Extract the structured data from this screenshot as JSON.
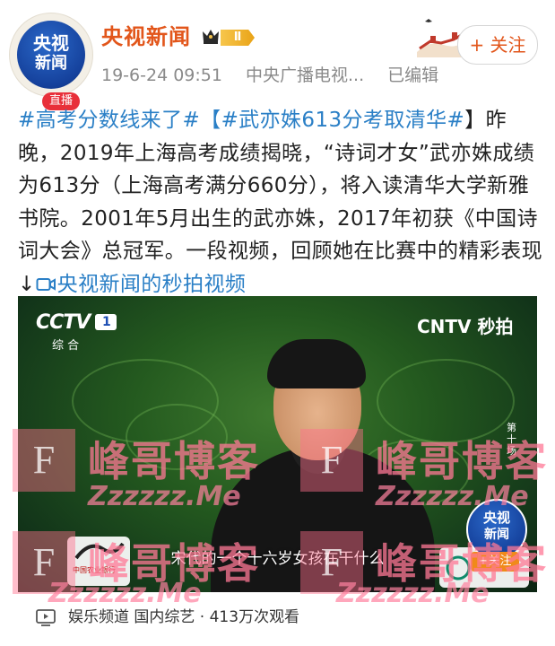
{
  "header": {
    "avatar_line1": "央视",
    "avatar_line2": "新闻",
    "avatar_badge": "直播",
    "user_name": "央视新闻",
    "vip_level": "Ⅱ",
    "timestamp": "19-6-24 09:51",
    "source": "中央广播电视...",
    "edited": "已编辑",
    "follow_label": "+ 关注"
  },
  "post": {
    "tag1": "#高考分数线来了#",
    "tag2_open": "【",
    "tag2": "#武亦姝613分考取清华#",
    "tag2_close": "】",
    "body": "昨晚，2019年上海高考成绩揭晓，“诗词才女”武亦姝成绩为613分（上海高考满分660分），将入读清华大学新雅书院。2001年5月出生的武亦姝，2017年初获《中国诗词大会》总冠军。一段视频，回顾她在比赛中的精彩表现↓",
    "video_link": "央视新闻的秒拍视频"
  },
  "video": {
    "channel_logo": "CCTV",
    "channel_number": "1",
    "channel_sub": "综 合",
    "platform_logo": "CNTV 秒拍",
    "side_label": "第十场",
    "subtitle": "宋代的一个十六岁女孩在干什么",
    "corner_avatar_line1": "央视",
    "corner_avatar_line2": "新闻",
    "corner_follow": "+关注",
    "bank_text": "中国农业银行"
  },
  "watermark": {
    "letter": "F",
    "title": "峰哥博客",
    "sub": "Zzzzzz.Me"
  },
  "footer": {
    "icon": "video-play-icon",
    "text": "娱乐频道 国内综艺 · 413万次观看"
  },
  "colors": {
    "username": "#e2561b",
    "link": "#2a7fc6",
    "live_badge": "#e8303a",
    "vip_badge": "#e9a317"
  }
}
